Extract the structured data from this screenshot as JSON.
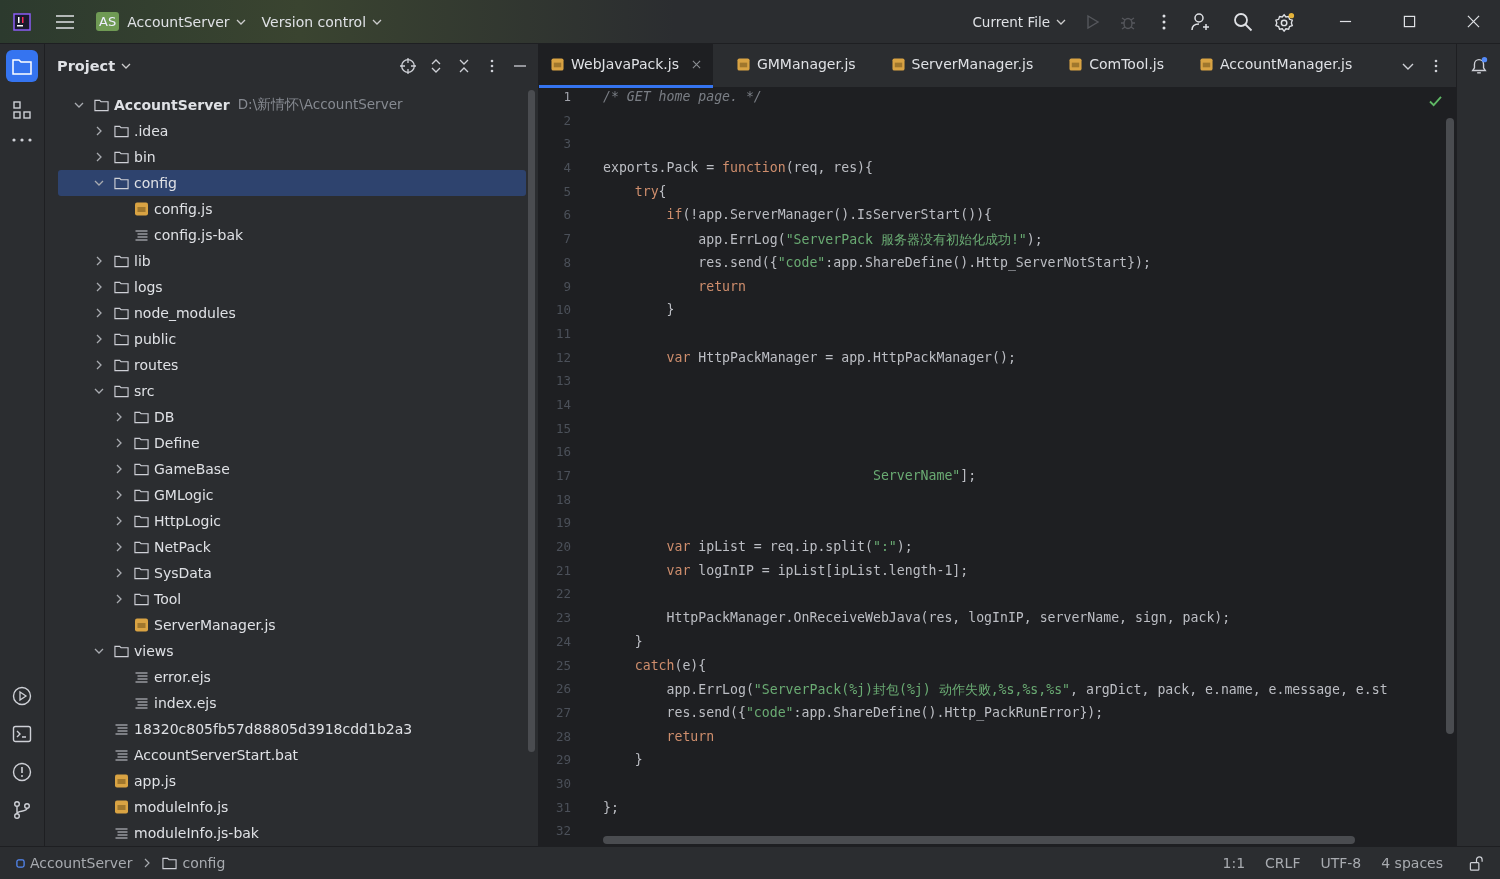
{
  "title_bar": {
    "project_badge": "AS",
    "project": "AccountServer",
    "vcs": "Version control",
    "run_config": "Current File"
  },
  "project_panel": {
    "title": "Project",
    "tree": [
      {
        "name": "AccountServer",
        "kind": "folder",
        "path": "D:\\新情怀\\AccountServer",
        "expanded": true,
        "selected": false,
        "children": [
          {
            "name": ".idea",
            "kind": "folder",
            "expanded": false,
            "selected": false
          },
          {
            "name": "bin",
            "kind": "folder",
            "expanded": false,
            "selected": false
          },
          {
            "name": "config",
            "kind": "folder",
            "expanded": true,
            "selected": true,
            "children": [
              {
                "name": "config.js",
                "kind": "js",
                "selected": false
              },
              {
                "name": "config.js-bak",
                "kind": "text",
                "selected": false
              }
            ]
          },
          {
            "name": "lib",
            "kind": "folder",
            "expanded": false,
            "selected": false
          },
          {
            "name": "logs",
            "kind": "folder",
            "expanded": false,
            "selected": false
          },
          {
            "name": "node_modules",
            "kind": "folder",
            "expanded": false,
            "selected": false
          },
          {
            "name": "public",
            "kind": "folder",
            "expanded": false,
            "selected": false
          },
          {
            "name": "routes",
            "kind": "folder",
            "expanded": false,
            "selected": false
          },
          {
            "name": "src",
            "kind": "folder",
            "expanded": true,
            "selected": false,
            "children": [
              {
                "name": "DB",
                "kind": "folder",
                "expanded": false,
                "selected": false
              },
              {
                "name": "Define",
                "kind": "folder",
                "expanded": false,
                "selected": false
              },
              {
                "name": "GameBase",
                "kind": "folder",
                "expanded": false,
                "selected": false
              },
              {
                "name": "GMLogic",
                "kind": "folder",
                "expanded": false,
                "selected": false
              },
              {
                "name": "HttpLogic",
                "kind": "folder",
                "expanded": false,
                "selected": false
              },
              {
                "name": "NetPack",
                "kind": "folder",
                "expanded": false,
                "selected": false
              },
              {
                "name": "SysData",
                "kind": "folder",
                "expanded": false,
                "selected": false
              },
              {
                "name": "Tool",
                "kind": "folder",
                "expanded": false,
                "selected": false
              },
              {
                "name": "ServerManager.js",
                "kind": "js",
                "selected": false
              }
            ]
          },
          {
            "name": "views",
            "kind": "folder",
            "expanded": true,
            "selected": false,
            "children": [
              {
                "name": "error.ejs",
                "kind": "text",
                "selected": false
              },
              {
                "name": "index.ejs",
                "kind": "text",
                "selected": false
              }
            ]
          },
          {
            "name": "18320c805fb57d88805d3918cdd1b2a3",
            "kind": "text",
            "selected": false
          },
          {
            "name": "AccountServerStart.bat",
            "kind": "text",
            "selected": false
          },
          {
            "name": "app.js",
            "kind": "js",
            "selected": false
          },
          {
            "name": "moduleInfo.js",
            "kind": "js",
            "selected": false
          },
          {
            "name": "moduleInfo.js-bak",
            "kind": "text",
            "selected": false
          }
        ]
      }
    ]
  },
  "editor": {
    "tabs": [
      {
        "label": "WebJavaPack.js",
        "selected": true
      },
      {
        "label": "GMManager.js",
        "selected": false
      },
      {
        "label": "ServerManager.js",
        "selected": false
      },
      {
        "label": "ComTool.js",
        "selected": false
      },
      {
        "label": "AccountManager.js",
        "selected": false
      }
    ],
    "lines": [
      {
        "number": "1",
        "tokens": [
          {
            "kind": "comment",
            "text": "/* GET home page. */"
          }
        ]
      },
      {
        "number": "2"
      },
      {
        "number": "3"
      },
      {
        "number": "4",
        "tokens": [
          {
            "kind": "plain",
            "text": "exports.Pack = "
          },
          {
            "kind": "keyword",
            "text": "function"
          },
          {
            "kind": "plain",
            "text": "(req, res){"
          }
        ]
      },
      {
        "number": "5",
        "tokens": [
          {
            "kind": "keyword",
            "text": "    try"
          },
          {
            "kind": "plain",
            "text": "{"
          }
        ]
      },
      {
        "number": "6",
        "tokens": [
          {
            "kind": "keyword",
            "text": "        if"
          },
          {
            "kind": "plain",
            "text": "(!app.ServerManager().IsServerStart()){"
          }
        ]
      },
      {
        "number": "7",
        "tokens": [
          {
            "kind": "plain",
            "text": "            app.ErrLog("
          },
          {
            "kind": "string",
            "text": "\"ServerPack 服务器没有初始化成功!\""
          },
          {
            "kind": "plain",
            "text": ");"
          }
        ]
      },
      {
        "number": "8",
        "tokens": [
          {
            "kind": "plain",
            "text": "            res.send({"
          },
          {
            "kind": "string",
            "text": "\"code\""
          },
          {
            "kind": "plain",
            "text": ":app.ShareDefine().Http_ServerNotStart});"
          }
        ]
      },
      {
        "number": "9",
        "tokens": [
          {
            "kind": "keyword",
            "text": "            return"
          }
        ]
      },
      {
        "number": "10",
        "tokens": [
          {
            "kind": "plain",
            "text": "        }"
          }
        ]
      },
      {
        "number": "11"
      },
      {
        "number": "12",
        "tokens": [
          {
            "kind": "keyword",
            "text": "        var"
          },
          {
            "kind": "plain",
            "text": " HttpPackManager = app.HttpPackManager();"
          }
        ]
      },
      {
        "number": "13"
      },
      {
        "number": "14"
      },
      {
        "number": "15"
      },
      {
        "number": "16"
      },
      {
        "number": "17",
        "tokens": [
          {
            "kind": "string",
            "text": "                                  ServerName\""
          },
          {
            "kind": "plain",
            "text": "];"
          }
        ]
      },
      {
        "number": "18"
      },
      {
        "number": "19"
      },
      {
        "number": "20",
        "tokens": [
          {
            "kind": "keyword",
            "text": "        var"
          },
          {
            "kind": "plain",
            "text": " ipList = req.ip.split("
          },
          {
            "kind": "string",
            "text": "\":\""
          },
          {
            "kind": "plain",
            "text": ");"
          }
        ]
      },
      {
        "number": "21",
        "tokens": [
          {
            "kind": "keyword",
            "text": "        var"
          },
          {
            "kind": "plain",
            "text": " logInIP = ipList[ipList.length-1];"
          }
        ]
      },
      {
        "number": "22"
      },
      {
        "number": "23",
        "tokens": [
          {
            "kind": "plain",
            "text": "        HttpPackManager.OnReceiveWebJava(res, logInIP, serverName, sign, pack);"
          }
        ]
      },
      {
        "number": "24",
        "tokens": [
          {
            "kind": "plain",
            "text": "    }"
          }
        ]
      },
      {
        "number": "25",
        "tokens": [
          {
            "kind": "keyword",
            "text": "    catch"
          },
          {
            "kind": "plain",
            "text": "(e){"
          }
        ]
      },
      {
        "number": "26",
        "tokens": [
          {
            "kind": "plain",
            "text": "        app.ErrLog("
          },
          {
            "kind": "string",
            "text": "\"ServerPack(%j)封包(%j) 动作失败,%s,%s,%s\""
          },
          {
            "kind": "plain",
            "text": ", argDict, pack, e.name, e.message, e.st"
          }
        ]
      },
      {
        "number": "27",
        "tokens": [
          {
            "kind": "plain",
            "text": "        res.send({"
          },
          {
            "kind": "string",
            "text": "\"code\""
          },
          {
            "kind": "plain",
            "text": ":app.ShareDefine().Http_PackRunError});"
          }
        ]
      },
      {
        "number": "28",
        "tokens": [
          {
            "kind": "keyword",
            "text": "        return"
          }
        ]
      },
      {
        "number": "29",
        "tokens": [
          {
            "kind": "plain",
            "text": "    }"
          }
        ]
      },
      {
        "number": "30"
      },
      {
        "number": "31",
        "tokens": [
          {
            "kind": "plain",
            "text": "};"
          }
        ]
      },
      {
        "number": "32"
      }
    ]
  },
  "status_bar": {
    "breadcrumbs": [
      {
        "label": "AccountServer",
        "kind": "module"
      },
      {
        "label": "config",
        "kind": "folder"
      }
    ],
    "position": "1:1",
    "line_ending": "CRLF",
    "encoding": "UTF-8",
    "indent": "4 spaces"
  }
}
